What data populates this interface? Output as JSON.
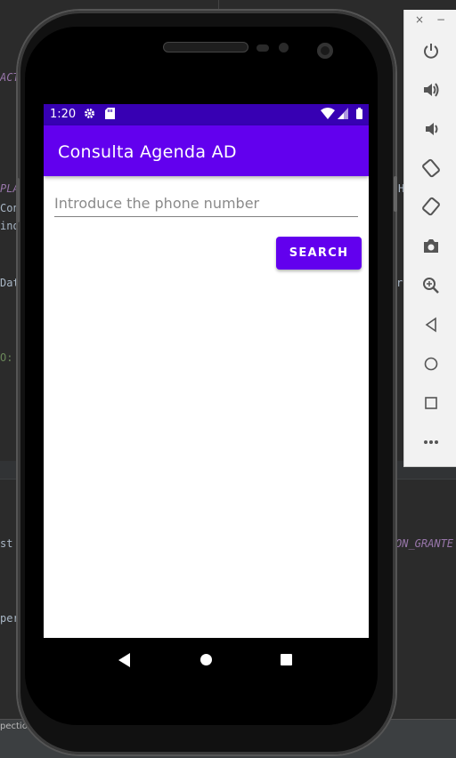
{
  "ide": {
    "code_fragments": [
      "ACT",
      "PLA",
      "Con",
      "ind",
      "Dat",
      "O:",
      "st",
      "per",
      "r",
      "H",
      "ON_GRANTE"
    ],
    "status_text": "pection"
  },
  "device": {
    "status_bar": {
      "time": "1:20",
      "icons": [
        "settings-icon",
        "sd-card-icon",
        "wifi-icon",
        "signal-icon",
        "battery-icon"
      ]
    },
    "app_bar": {
      "title": "Consulta Agenda AD"
    },
    "form": {
      "phone_input": {
        "placeholder": "Introduce the phone number",
        "value": ""
      },
      "search_button": "SEARCH"
    },
    "nav_bar": [
      "back-icon",
      "home-icon",
      "recents-icon"
    ]
  },
  "emulator_toolbar": {
    "window_controls": [
      "×",
      "−"
    ],
    "tools": [
      "power-icon",
      "volume-up-icon",
      "volume-down-icon",
      "rotate-left-icon",
      "rotate-right-icon",
      "camera-icon",
      "zoom-icon",
      "back-icon",
      "home-icon",
      "overview-icon",
      "more-icon"
    ]
  },
  "colors": {
    "primary": "#6200ee",
    "primary_dark": "#3700b3",
    "ide_background": "#2b2b2b"
  }
}
